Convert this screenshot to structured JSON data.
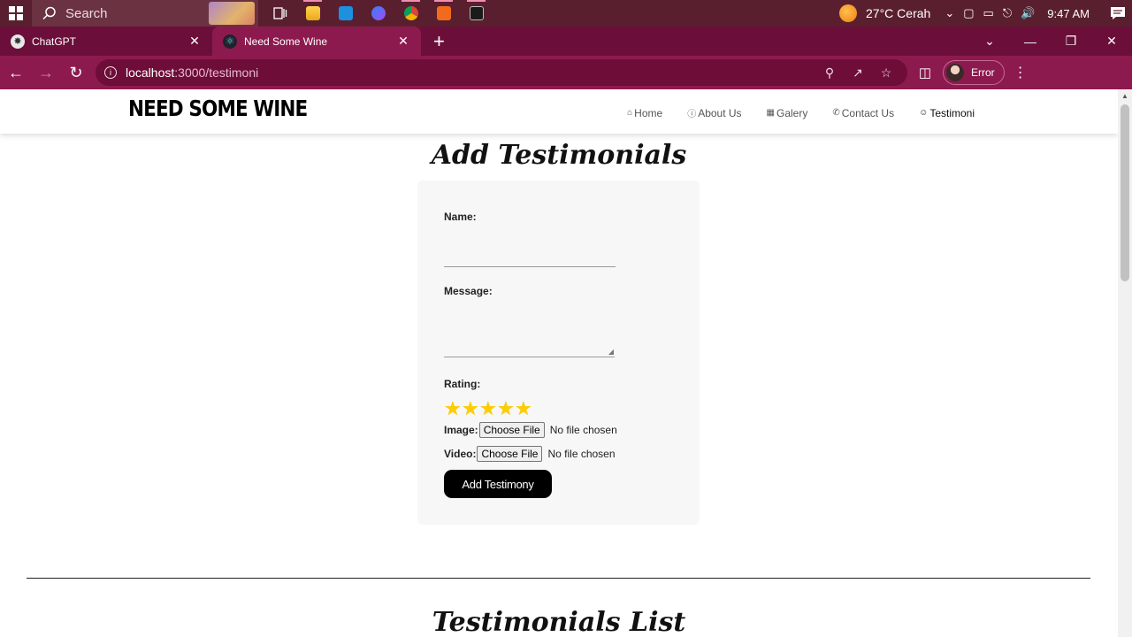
{
  "taskbar": {
    "search_label": "Search",
    "weather": "27°C  Cerah",
    "time": "9:47 AM"
  },
  "tabs": [
    {
      "title": "ChatGPT",
      "icon": "chatgpt-icon"
    },
    {
      "title": "Need Some Wine",
      "icon": "react-icon"
    }
  ],
  "omnibox": {
    "host": "localhost",
    "path": ":3000/testimoni"
  },
  "profile": {
    "label": "Error"
  },
  "site": {
    "brand": "NEED SOME WINE",
    "menu": [
      {
        "label": "Home",
        "icon": "home-icon"
      },
      {
        "label": "About Us",
        "icon": "info-icon"
      },
      {
        "label": "Galery",
        "icon": "image-icon"
      },
      {
        "label": "Contact Us",
        "icon": "phone-icon"
      },
      {
        "label": "Testimoni",
        "icon": "user-icon"
      }
    ]
  },
  "form": {
    "title": "Add Testimonials",
    "name_label": "Name:",
    "name_value": "",
    "message_label": "Message:",
    "message_value": "",
    "rating_label": "Rating:",
    "rating": 5,
    "image_label": "Image:",
    "video_label": "Video:",
    "choose_file": "Choose File",
    "no_file": "No file chosen",
    "submit_label": "Add Testimony"
  },
  "list": {
    "title": "Testimonials List"
  }
}
